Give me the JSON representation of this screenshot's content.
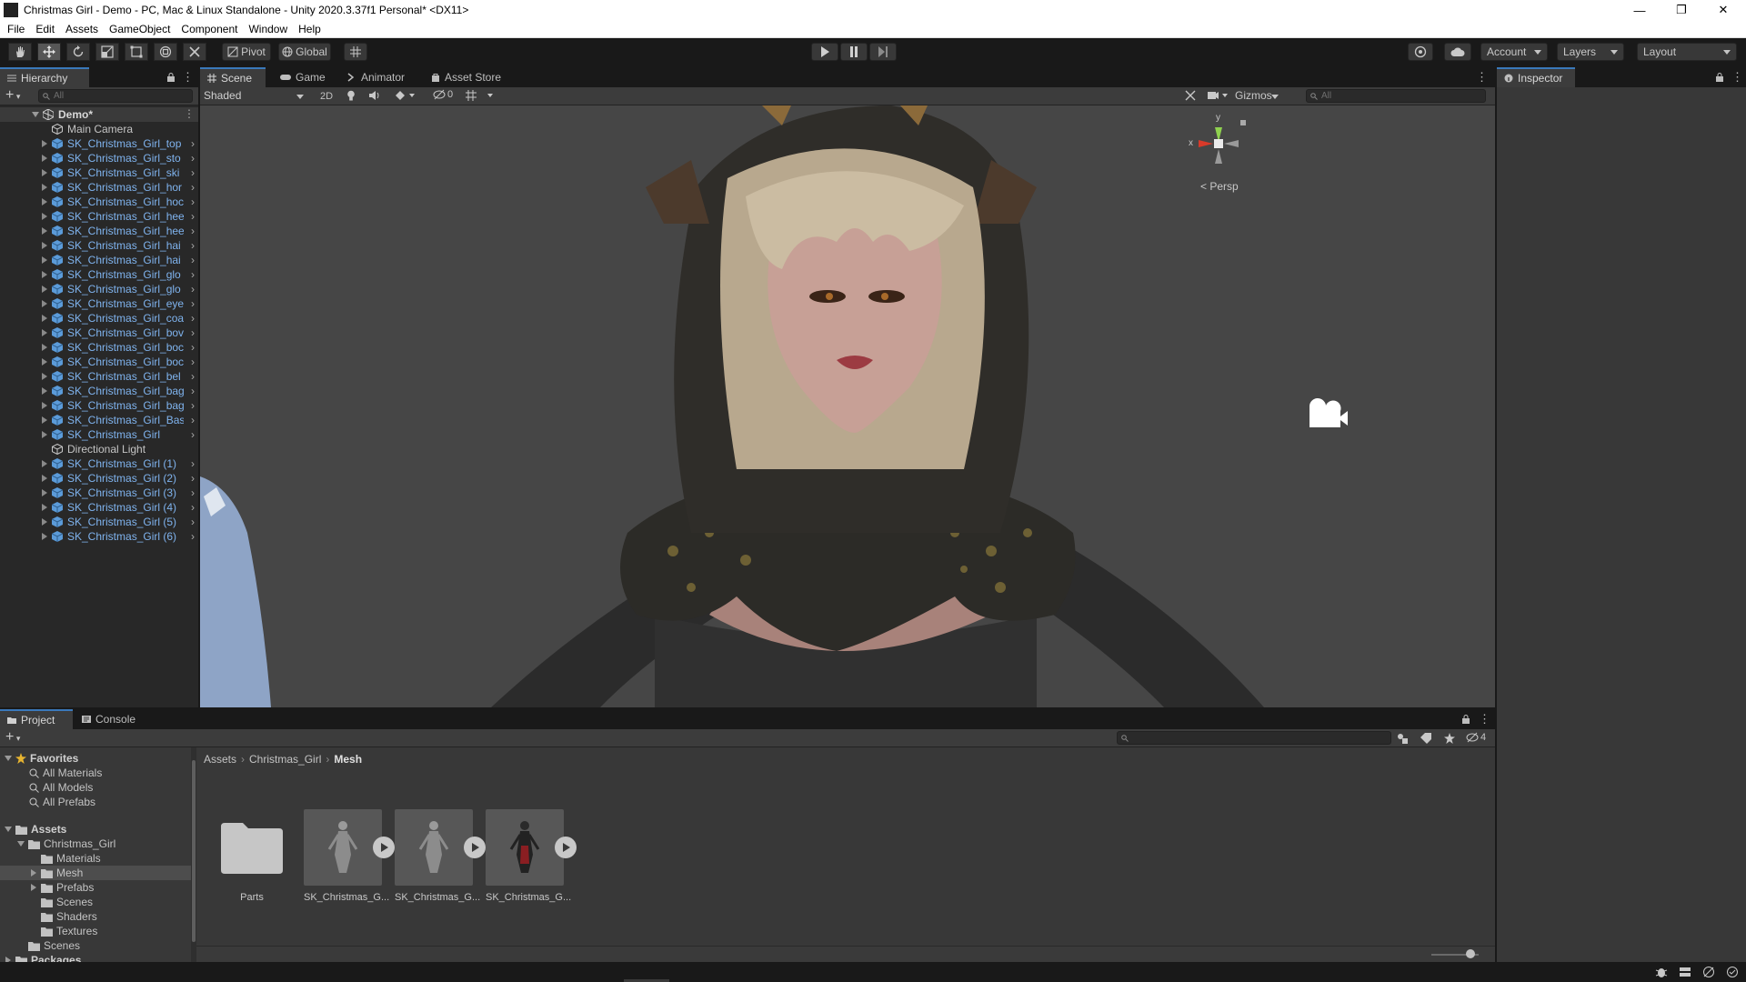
{
  "window": {
    "title": "Christmas Girl - Demo - PC, Mac & Linux Standalone - Unity 2020.3.37f1 Personal* <DX11>"
  },
  "menu": [
    "File",
    "Edit",
    "Assets",
    "GameObject",
    "Component",
    "Window",
    "Help"
  ],
  "toolbar": {
    "pivot_label": "Pivot",
    "global_label": "Global",
    "account_label": "Account",
    "layers_label": "Layers",
    "layout_label": "Layout"
  },
  "hierarchy": {
    "tab_label": "Hierarchy",
    "search_placeholder": "All",
    "scene_name": "Demo*",
    "items": [
      "Main Camera",
      "SK_Christmas_Girl_top",
      "SK_Christmas_Girl_sto",
      "SK_Christmas_Girl_ski",
      "SK_Christmas_Girl_hor",
      "SK_Christmas_Girl_hoc",
      "SK_Christmas_Girl_hee",
      "SK_Christmas_Girl_hee",
      "SK_Christmas_Girl_hai",
      "SK_Christmas_Girl_hai",
      "SK_Christmas_Girl_glo",
      "SK_Christmas_Girl_glo",
      "SK_Christmas_Girl_eye",
      "SK_Christmas_Girl_coa",
      "SK_Christmas_Girl_bov",
      "SK_Christmas_Girl_boc",
      "SK_Christmas_Girl_boc",
      "SK_Christmas_Girl_bel",
      "SK_Christmas_Girl_bag",
      "SK_Christmas_Girl_bag",
      "SK_Christmas_Girl_Bas",
      "SK_Christmas_Girl",
      "Directional Light",
      "SK_Christmas_Girl (1)",
      "SK_Christmas_Girl (2)",
      "SK_Christmas_Girl (3)",
      "SK_Christmas_Girl (4)",
      "SK_Christmas_Girl (5)",
      "SK_Christmas_Girl (6)"
    ]
  },
  "scene": {
    "tabs": [
      "Scene",
      "Game",
      "Animator",
      "Asset Store"
    ],
    "shading_mode": "Shaded",
    "mode_2d": "2D",
    "hidden_count": "0",
    "gizmos_label": "Gizmos",
    "search_placeholder": "All",
    "projection_label": "Persp",
    "axis_x": "x",
    "axis_y": "y"
  },
  "inspector": {
    "tab_label": "Inspector"
  },
  "project": {
    "tabs": [
      "Project",
      "Console"
    ],
    "favorites_label": "Favorites",
    "favorites": [
      "All Materials",
      "All Models",
      "All Prefabs"
    ],
    "assets_label": "Assets",
    "tree": [
      "Christmas_Girl",
      "Materials",
      "Mesh",
      "Prefabs",
      "Scenes",
      "Shaders",
      "Textures",
      "Scenes"
    ],
    "packages_label": "Packages",
    "breadcrumb": [
      "Assets",
      "Christmas_Girl",
      "Mesh"
    ],
    "hidden_count": "4",
    "assets": [
      "Parts",
      "SK_Christmas_G...",
      "SK_Christmas_G...",
      "SK_Christmas_G..."
    ]
  },
  "colors": {
    "selection_blue": "#2c5d87",
    "prefab_blue": "#7fb3ee",
    "viewport_bg": "#464646"
  }
}
